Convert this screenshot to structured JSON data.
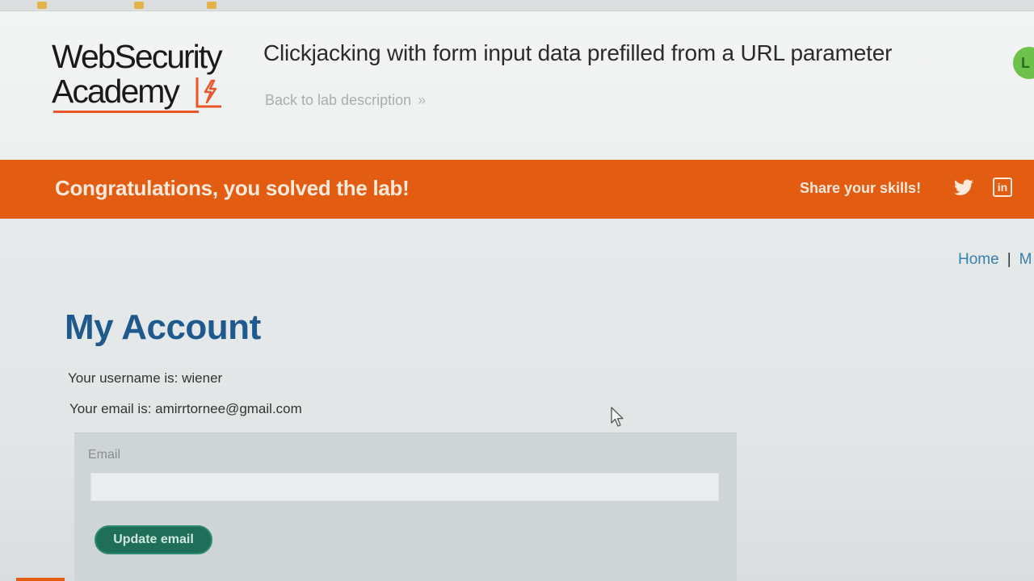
{
  "header": {
    "logo_line1": "WebSecurity",
    "logo_line2": "Academy",
    "lab_title": "Clickjacking with form input data prefilled from a URL parameter",
    "back_link": "Back to lab description",
    "back_chevron": "»",
    "status_letter": "L"
  },
  "banner": {
    "message": "Congratulations, you solved the lab!",
    "share_label": "Share your skills!",
    "linkedin_text": "in"
  },
  "nav": {
    "home": "Home",
    "separator": "|",
    "next_partial": "M"
  },
  "account": {
    "title": "My Account",
    "username_line": "Your username is: wiener",
    "email_line": "Your email is: amirrtornee@gmail.com"
  },
  "form": {
    "email_label": "Email",
    "email_value": "",
    "update_button": "Update email"
  },
  "colors": {
    "banner": "#e25d12",
    "title_blue": "#1e5a8e",
    "link_blue": "#3a7fb1",
    "button_green": "#1e6e5a",
    "logo_orange": "#e8582a"
  },
  "icons": [
    "lightning-bolt-icon",
    "twitter-icon",
    "linkedin-icon",
    "chevron-right-icon",
    "mouse-cursor-icon"
  ]
}
